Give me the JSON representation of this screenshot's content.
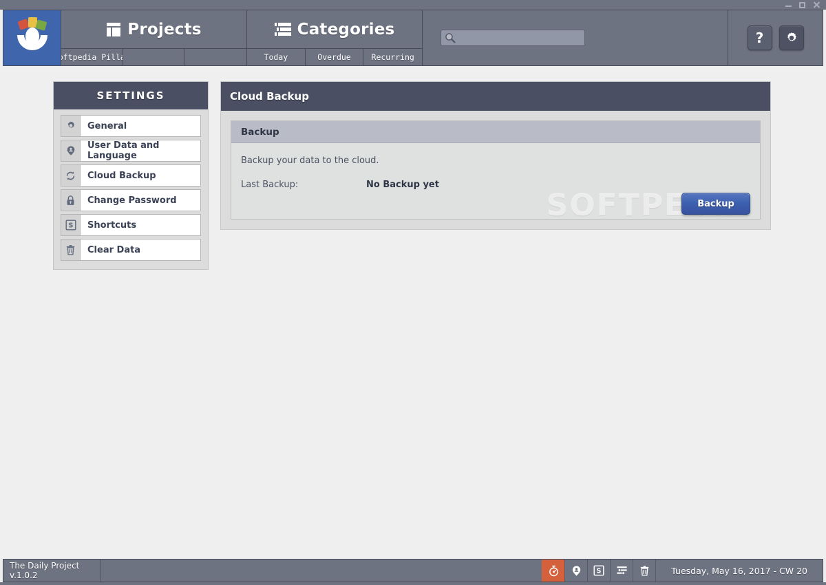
{
  "window": {
    "minimize_label": "minimize",
    "maximize_label": "maximize",
    "close_label": "close"
  },
  "header": {
    "logo_name": "the-daily-project-logo",
    "nav": [
      {
        "id": "projects",
        "label": "Projects",
        "icon": "columns-layout-icon",
        "subtabs": [
          "Softpedia Pillar",
          "",
          ""
        ]
      },
      {
        "id": "categories",
        "label": "Categories",
        "icon": "list-lines-icon",
        "subtabs": [
          "Today",
          "Overdue",
          "Recurring"
        ]
      }
    ],
    "search": {
      "value": "",
      "placeholder": "",
      "icon": "search-icon"
    },
    "help_button": "?",
    "settings_button_icon": "gear-icon"
  },
  "sidebar": {
    "title": "SETTINGS",
    "items": [
      {
        "label": "General",
        "icon": "gear-icon"
      },
      {
        "label": "User Data and Language",
        "icon": "person-pin-icon"
      },
      {
        "label": "Cloud Backup",
        "icon": "sync-refresh-icon"
      },
      {
        "label": "Change Password",
        "icon": "lock-icon"
      },
      {
        "label": "Shortcuts",
        "icon": "letter-s-box-icon"
      },
      {
        "label": "Clear Data",
        "icon": "trash-icon"
      }
    ]
  },
  "main": {
    "title": "Cloud Backup",
    "card": {
      "title": "Backup",
      "description": "Backup your data to the cloud.",
      "last_backup_label": "Last Backup:",
      "last_backup_value": "No Backup yet",
      "button_label": "Backup"
    },
    "watermark": "SOFTPEDIA"
  },
  "footer": {
    "version": "The Daily Project v.1.0.2",
    "tools": [
      {
        "name": "timer-stopwatch-icon",
        "active": true
      },
      {
        "name": "person-pin-icon",
        "active": false
      },
      {
        "name": "letter-s-box-icon",
        "active": false
      },
      {
        "name": "list-settings-icon",
        "active": false
      },
      {
        "name": "trash-icon",
        "active": false
      }
    ],
    "date": "Tuesday, May 16, 2017 - CW 20"
  },
  "colors": {
    "header_bg": "#6e7382",
    "panel_header_bg": "#4a4f63",
    "logo_bg": "#3f66ad",
    "accent_button": "#3c5fae",
    "active_tool": "#d4613c",
    "page_bg": "#efefef"
  }
}
